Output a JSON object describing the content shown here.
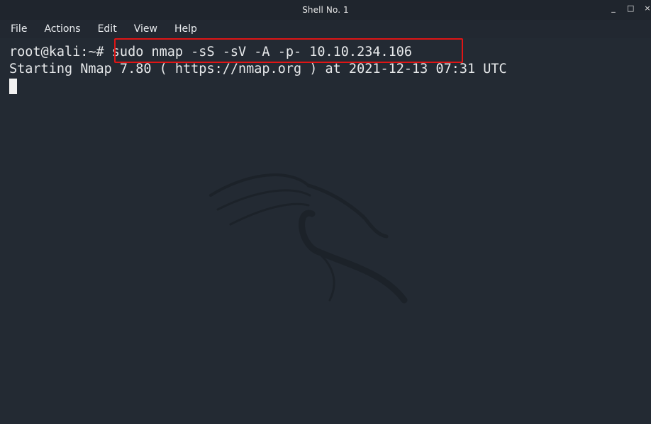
{
  "window": {
    "title": "Shell No. 1",
    "controls": {
      "minimize": "_",
      "maximize": "□",
      "close": "×"
    }
  },
  "menu": {
    "items": [
      "File",
      "Actions",
      "Edit",
      "View",
      "Help"
    ]
  },
  "terminal": {
    "prompt": "root@kali:~#",
    "command": " sudo nmap -sS -sV -A -p- 10.10.234.106",
    "output": "Starting Nmap 7.80 ( https://nmap.org ) at 2021-12-13 07:31 UTC"
  },
  "colors": {
    "background": "#232a33",
    "highlight": "#e01515",
    "text": "#e6e8ea"
  },
  "icons": {
    "watermark": "kali-dragon-logo"
  }
}
